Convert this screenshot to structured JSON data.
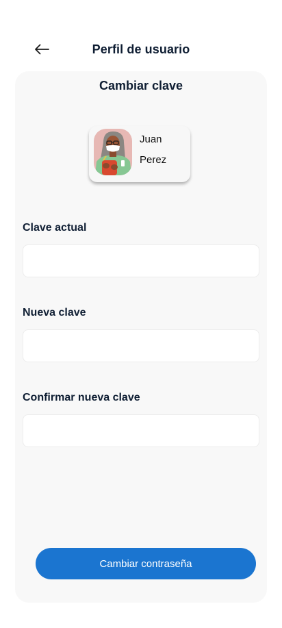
{
  "header": {
    "back_icon": "arrow-left-icon",
    "title": "Perfil de usuario"
  },
  "card": {
    "title": "Cambiar clave",
    "user": {
      "first_name": "Juan",
      "last_name": "Perez",
      "avatar": "doctor-avatar"
    },
    "fields": [
      {
        "label": "Clave actual",
        "value": "",
        "placeholder": ""
      },
      {
        "label": "Nueva clave",
        "value": "",
        "placeholder": ""
      },
      {
        "label": "Confirmar nueva clave",
        "value": "",
        "placeholder": ""
      }
    ],
    "submit_label": "Cambiar contraseña"
  },
  "colors": {
    "primary": "#1b75d0",
    "text": "#0f1e33",
    "card_background": "#f8f8f8"
  }
}
